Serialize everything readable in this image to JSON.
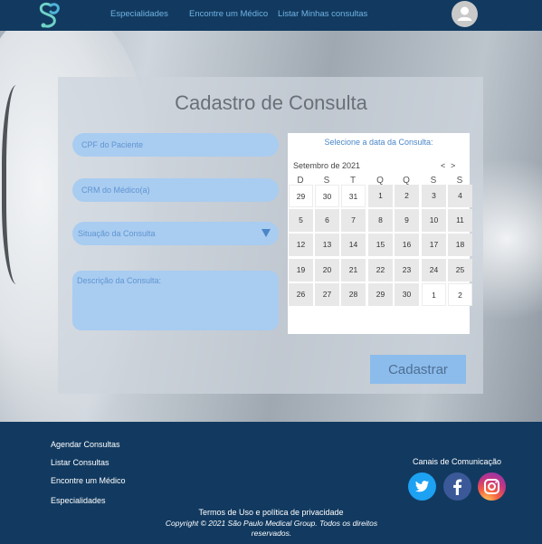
{
  "header": {
    "nav": [
      {
        "label": "Especialidades"
      },
      {
        "label": "Encontre um Médico"
      },
      {
        "label": "Listar Minhas consultas"
      }
    ]
  },
  "form": {
    "title": "Cadastro de Consulta",
    "cpf_placeholder": "CPF do Paciente",
    "crm_placeholder": "CRM do Médico(a)",
    "status_placeholder": "Situação da Consulta",
    "description_placeholder": "Descrição da Consulta:",
    "submit_label": "Cadastrar"
  },
  "calendar": {
    "title": "Selecione a data da Consulta:",
    "month_label": "Setembro de 2021",
    "prev": "<",
    "next": ">",
    "weekdays": [
      "D",
      "S",
      "T",
      "Q",
      "Q",
      "S",
      "S"
    ],
    "weeks": [
      [
        "29",
        "30",
        "31",
        "1",
        "2",
        "3",
        "4"
      ],
      [
        "5",
        "6",
        "7",
        "8",
        "9",
        "10",
        "11"
      ],
      [
        "12",
        "13",
        "14",
        "15",
        "16",
        "17",
        "18"
      ],
      [
        "19",
        "20",
        "21",
        "22",
        "23",
        "24",
        "25"
      ],
      [
        "26",
        "27",
        "28",
        "29",
        "30",
        "1",
        "2"
      ]
    ]
  },
  "footer": {
    "links": [
      {
        "label": "Agendar Consultas"
      },
      {
        "label": "Listar Consultas"
      },
      {
        "label": "Encontre um Médico"
      },
      {
        "label": "Especialidades"
      }
    ],
    "channels_label": "Canais de Comunicação",
    "terms": "Termos de Uso e política de privacidade",
    "copyright": "Copyright © 2021 São Paulo Medical Group. Todos os direitos reservados."
  },
  "colors": {
    "header_bg": "#123a60",
    "nav_link": "#6fb3e3",
    "field_bg": "#a9ccf1",
    "button_bg": "#8cbcec"
  },
  "icons": {
    "logo": "stethoscope-s-logo",
    "avatar": "user-avatar-icon",
    "twitter": "twitter-icon",
    "facebook": "facebook-icon",
    "instagram": "instagram-icon",
    "dropdown": "dropdown-arrow-icon"
  }
}
